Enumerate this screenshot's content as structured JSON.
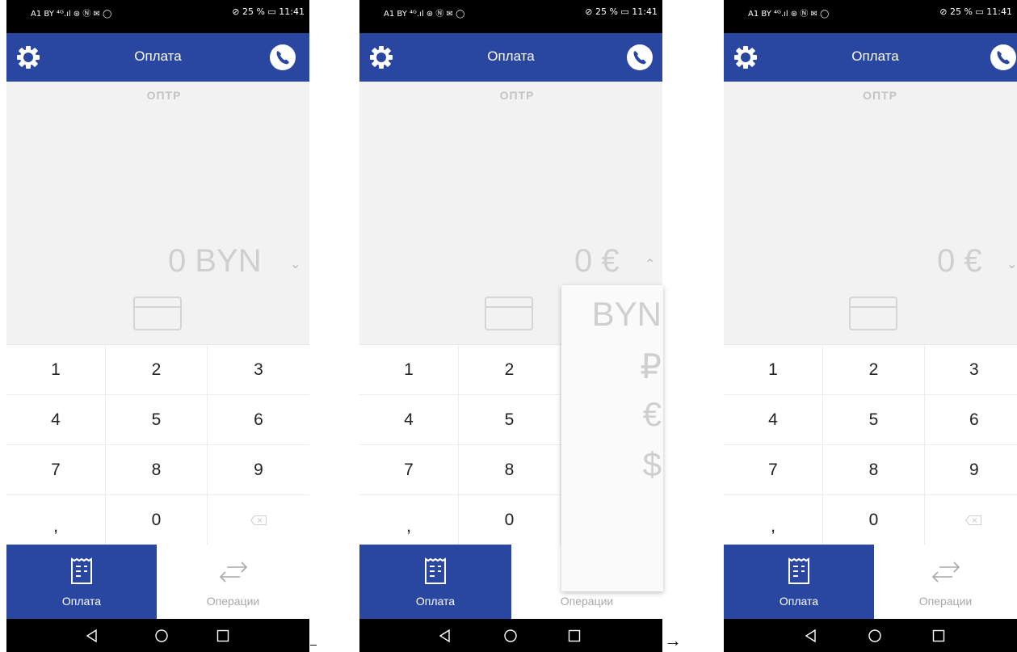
{
  "status": {
    "left": "A1 BY ⁴ᴳ.ıl ⊛ Ⓝ ✉ ◯",
    "right": "⊘ 25 % ▭ 11:41"
  },
  "appbar": {
    "title": "Оплата"
  },
  "merchant": "ОПТР",
  "screens": [
    {
      "amount": "0 BYN",
      "chevron": "⌄"
    },
    {
      "amount": "0 €",
      "chevron": "⌃"
    },
    {
      "amount": "0 €",
      "chevron": "⌄"
    }
  ],
  "keypad": {
    "keys": [
      "1",
      "2",
      "3",
      "4",
      "5",
      "6",
      "7",
      "8",
      "9",
      ",",
      "0",
      "⌫"
    ]
  },
  "tabs": {
    "pay": "Оплата",
    "operations": "Операции"
  },
  "currency_menu": {
    "options": [
      "BYN",
      "₽",
      "€",
      "$"
    ]
  },
  "transition_arrow": "→",
  "colors": {
    "primary": "#2946a0",
    "display_bg": "#f2f2f2",
    "muted": "#cfcfcf"
  }
}
